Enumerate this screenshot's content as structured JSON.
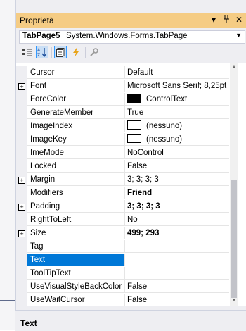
{
  "window": {
    "title": "Proprietà",
    "title_icons": [
      "dropdown-arrow-icon",
      "pin-icon",
      "close-icon"
    ]
  },
  "object_selector": {
    "name": "TabPage5",
    "type": "System.Windows.Forms.TabPage"
  },
  "toolbar": {
    "buttons": [
      "categorized-icon",
      "alphabetical-icon",
      "properties-icon",
      "events-icon",
      "property-pages-icon"
    ]
  },
  "properties": [
    {
      "name": "Cursor",
      "value": "Default",
      "expandable": false,
      "bold": false
    },
    {
      "name": "Font",
      "value": "Microsoft Sans Serif; 8,25pt",
      "expandable": true,
      "bold": false
    },
    {
      "name": "ForeColor",
      "value": "ControlText",
      "expandable": false,
      "bold": false,
      "swatch": "#000000"
    },
    {
      "name": "GenerateMember",
      "value": "True",
      "expandable": false,
      "bold": false
    },
    {
      "name": "ImageIndex",
      "value": "(nessuno)",
      "expandable": false,
      "bold": false,
      "swatch": "#ffffff"
    },
    {
      "name": "ImageKey",
      "value": "(nessuno)",
      "expandable": false,
      "bold": false,
      "swatch": "#ffffff"
    },
    {
      "name": "ImeMode",
      "value": "NoControl",
      "expandable": false,
      "bold": false
    },
    {
      "name": "Locked",
      "value": "False",
      "expandable": false,
      "bold": false
    },
    {
      "name": "Margin",
      "value": "3; 3; 3; 3",
      "expandable": true,
      "bold": false
    },
    {
      "name": "Modifiers",
      "value": "Friend",
      "expandable": false,
      "bold": true
    },
    {
      "name": "Padding",
      "value": "3; 3; 3; 3",
      "expandable": true,
      "bold": true
    },
    {
      "name": "RightToLeft",
      "value": "No",
      "expandable": false,
      "bold": false
    },
    {
      "name": "Size",
      "value": "499; 293",
      "expandable": true,
      "bold": true
    },
    {
      "name": "Tag",
      "value": "",
      "expandable": false,
      "bold": false
    },
    {
      "name": "Text",
      "value": "",
      "expandable": false,
      "bold": false,
      "selected": true
    },
    {
      "name": "ToolTipText",
      "value": "",
      "expandable": false,
      "bold": false
    },
    {
      "name": "UseVisualStyleBackColor",
      "value": "False",
      "expandable": false,
      "bold": false
    },
    {
      "name": "UseWaitCursor",
      "value": "False",
      "expandable": false,
      "bold": false
    }
  ],
  "description": {
    "title": "Text"
  },
  "colors": {
    "title_bar": "#f5cc84",
    "selection": "#0078d7"
  }
}
